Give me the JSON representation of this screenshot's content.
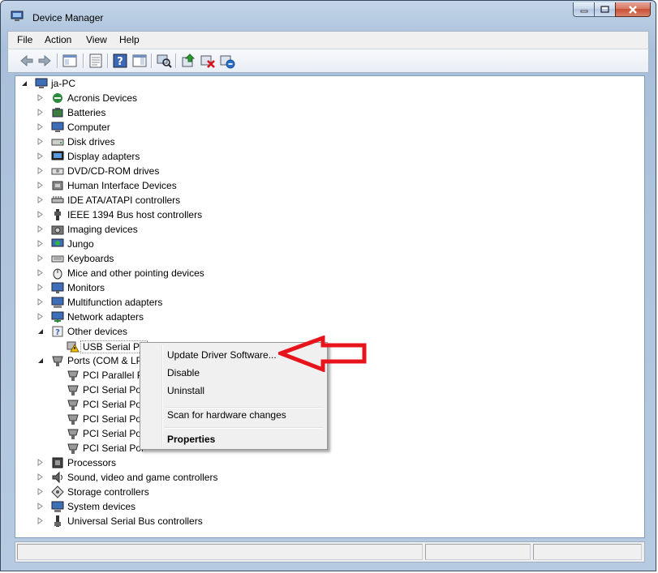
{
  "window": {
    "title": "Device Manager",
    "caption_buttons": [
      "minimize-icon",
      "maximize-icon",
      "close-icon"
    ]
  },
  "menu": [
    "File",
    "Action",
    "View",
    "Help"
  ],
  "toolbar": {
    "buttons": [
      "back-arrow-icon",
      "forward-arrow-icon",
      "show-hide-console-tree-icon",
      "properties-icon",
      "help-icon",
      "action-pane-icon",
      "scan-hardware-changes-icon",
      "update-driver-icon",
      "disable-device-icon",
      "uninstall-device-icon"
    ]
  },
  "tree": {
    "root": "ja-PC",
    "categories": [
      "Acronis Devices",
      "Batteries",
      "Computer",
      "Disk drives",
      "Display adapters",
      "DVD/CD-ROM drives",
      "Human Interface Devices",
      "IDE ATA/ATAPI controllers",
      "IEEE 1394 Bus host controllers",
      "Imaging devices",
      "Jungo",
      "Keyboards",
      "Mice and other pointing devices",
      "Monitors",
      "Multifunction adapters",
      "Network adapters",
      "Other devices",
      "USB Serial Po",
      "Ports (COM & LP",
      "PCI Parallel P",
      "PCI Serial Por",
      "PCI Serial Por",
      "PCI Serial Por",
      "PCI Serial Por",
      "PCI Serial Por",
      "Processors",
      "Sound, video and game controllers",
      "Storage controllers",
      "System devices",
      "Universal Serial Bus controllers"
    ]
  },
  "context_menu": {
    "items": [
      "Update Driver Software...",
      "Disable",
      "Uninstall",
      "Scan for hardware changes",
      "Properties"
    ]
  },
  "annotation": {
    "arrow_color": "#e8141c"
  },
  "colors": {
    "selection_border": "#8a8a8a",
    "window_frame": "#b6cbe1",
    "warning": "#f5c400"
  }
}
